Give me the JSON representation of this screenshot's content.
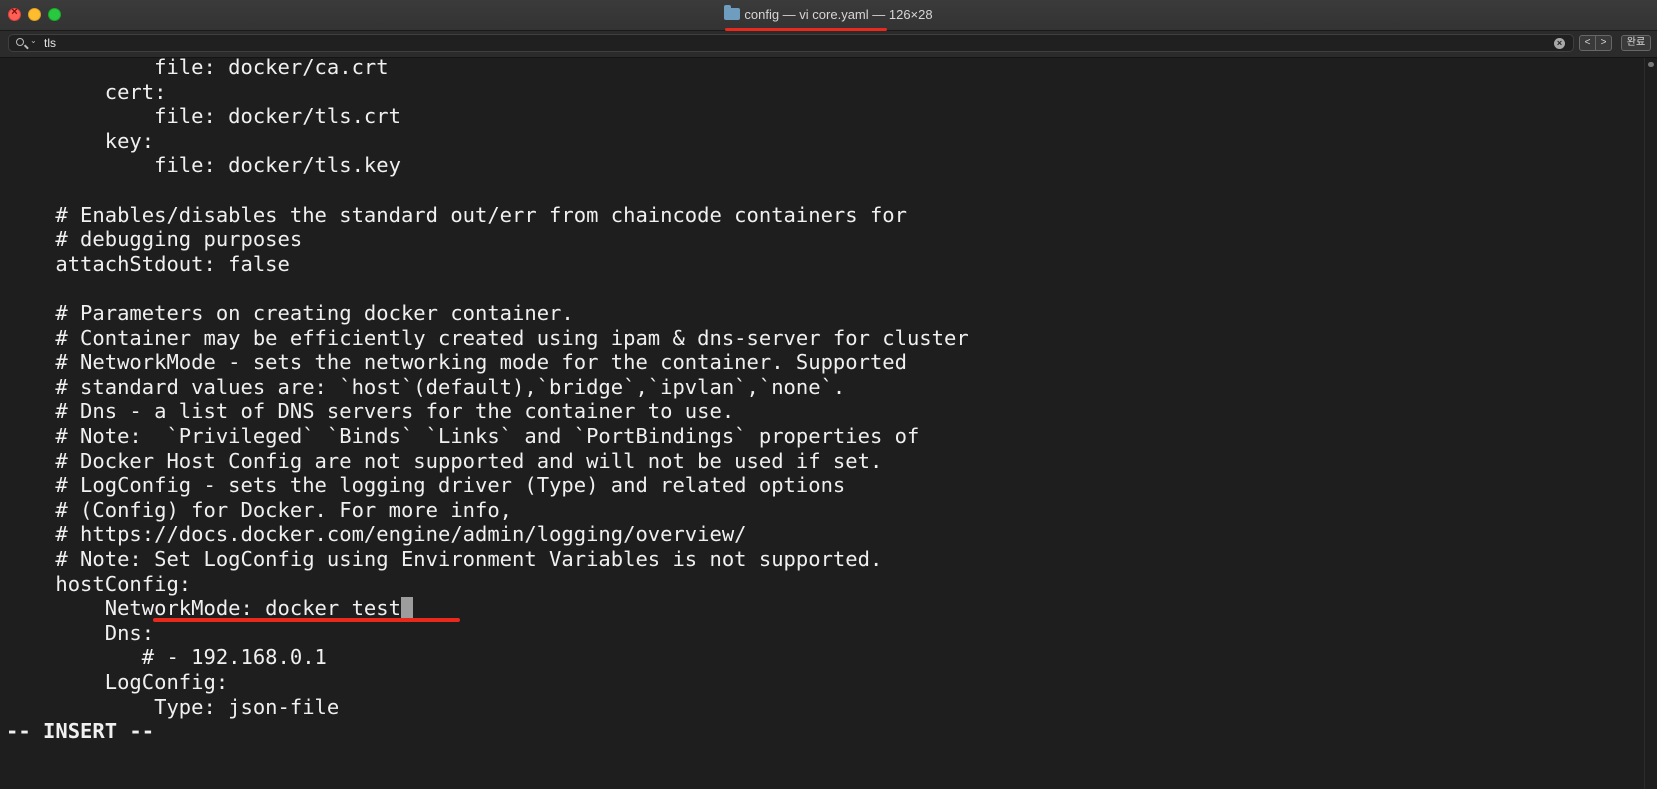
{
  "window": {
    "title": "config — vi core.yaml — 126×28",
    "accent_color": "#e8291c",
    "controls": [
      "close-icon",
      "minimize-icon",
      "zoom-icon"
    ]
  },
  "findbar": {
    "query": "tls",
    "prev_label": "<",
    "next_label": ">",
    "done_label": "완료",
    "clear_label": "×"
  },
  "editor": {
    "lines": [
      "            file: docker/ca.crt",
      "        cert:",
      "            file: docker/tls.crt",
      "        key:",
      "            file: docker/tls.key",
      "",
      "    # Enables/disables the standard out/err from chaincode containers for",
      "    # debugging purposes",
      "    attachStdout: false",
      "",
      "    # Parameters on creating docker container.",
      "    # Container may be efficiently created using ipam & dns-server for cluster",
      "    # NetworkMode - sets the networking mode for the container. Supported",
      "    # standard values are: `host`(default),`bridge`,`ipvlan`,`none`.",
      "    # Dns - a list of DNS servers for the container to use.",
      "    # Note:  `Privileged` `Binds` `Links` and `PortBindings` properties of",
      "    # Docker Host Config are not supported and will not be used if set.",
      "    # LogConfig - sets the logging driver (Type) and related options",
      "    # (Config) for Docker. For more info,",
      "    # https://docs.docker.com/engine/admin/logging/overview/",
      "    # Note: Set LogConfig using Environment Variables is not supported.",
      "    hostConfig:",
      "        NetworkMode: docker_test",
      "        Dns:",
      "           # - 192.168.0.1",
      "        LogConfig:",
      "            Type: json-file",
      "-- INSERT --"
    ]
  }
}
